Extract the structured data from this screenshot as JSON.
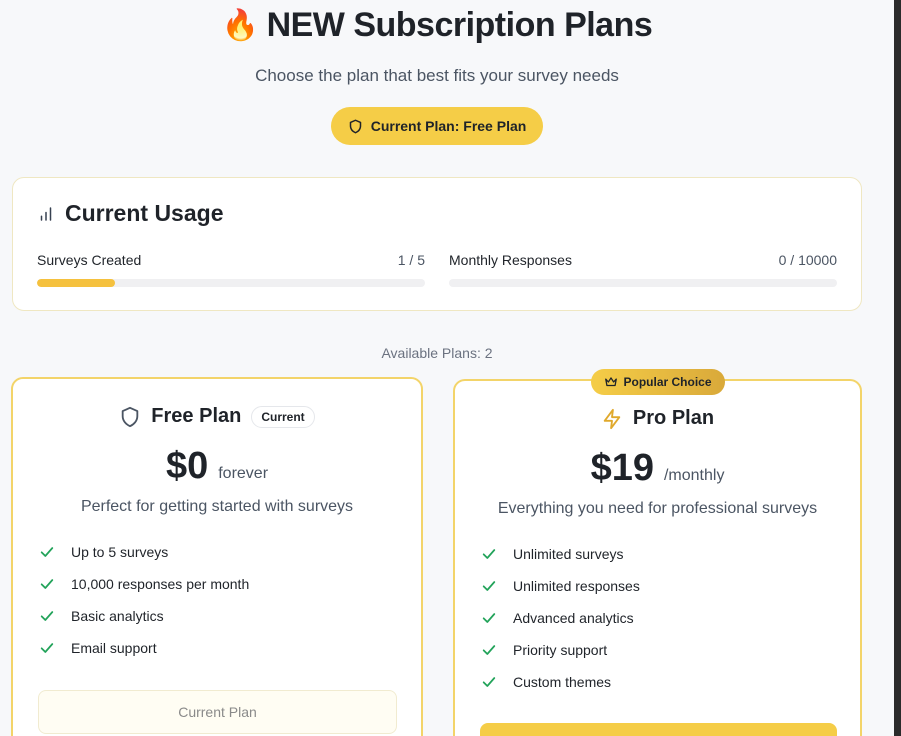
{
  "header": {
    "emoji": "🔥",
    "title": "NEW Subscription Plans",
    "subtitle": "Choose the plan that best fits your survey needs",
    "current_plan_badge": "Current Plan: Free Plan"
  },
  "usage": {
    "title": "Current Usage",
    "metrics": [
      {
        "label": "Surveys Created",
        "value": "1 / 5",
        "progress": 0.2
      },
      {
        "label": "Monthly Responses",
        "value": "0 / 10000",
        "progress": 0
      }
    ]
  },
  "available_plans": "Available Plans: 2",
  "plans": {
    "free": {
      "name": "Free Plan",
      "chip": "Current",
      "price": "$0",
      "period": "forever",
      "description": "Perfect for getting started with surveys",
      "features": [
        "Up to 5 surveys",
        "10,000 responses per month",
        "Basic analytics",
        "Email support"
      ],
      "button_label": "Current Plan"
    },
    "pro": {
      "badge": "Popular Choice",
      "name": "Pro Plan",
      "price": "$19",
      "period": "/monthly",
      "description": "Everything you need for professional surveys",
      "features": [
        "Unlimited surveys",
        "Unlimited responses",
        "Advanced analytics",
        "Priority support",
        "Custom themes"
      ]
    }
  },
  "colors": {
    "accent": "#f5cd47",
    "check": "#22a35a",
    "border": "#f3d469"
  }
}
